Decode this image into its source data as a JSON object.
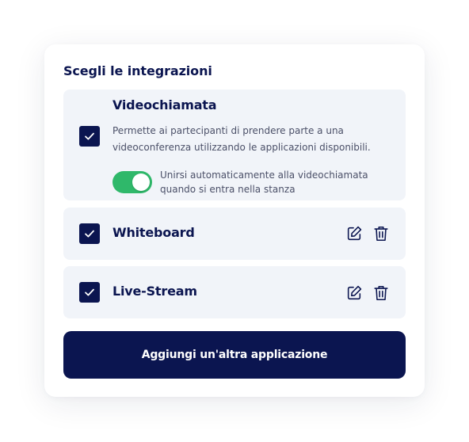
{
  "section": {
    "title": "Scegli le integrazioni"
  },
  "integrations": [
    {
      "name": "Videochiamata",
      "checked": true,
      "description": "Permette ai partecipanti di prendere parte a una videoconferenza utilizzando le applicazioni disponibili.",
      "toggle_label": "Unirsi automaticamente alla videochiamata quando si entra nella stanza",
      "toggle_on": true
    },
    {
      "name": "Whiteboard",
      "checked": true,
      "actions": [
        "edit-icon",
        "trash-icon"
      ]
    },
    {
      "name": "Live-Stream",
      "checked": true,
      "actions": [
        "edit-icon",
        "trash-icon"
      ]
    }
  ],
  "add_button": {
    "label": "Aggiungi un'altra applicazione"
  },
  "colors": {
    "primary": "#0b1550",
    "panel_bg": "#f1f4f9",
    "toggle_on": "#2fb86a",
    "text_muted": "#4b5068"
  }
}
